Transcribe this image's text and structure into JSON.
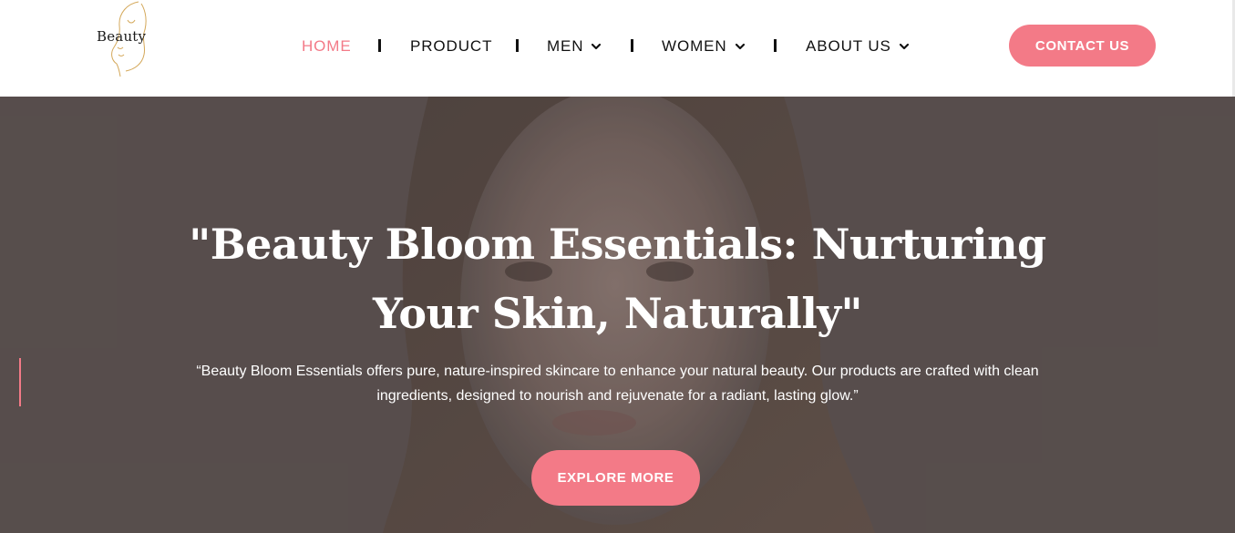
{
  "brand": {
    "logo_text": "Beauty"
  },
  "nav": {
    "items": [
      {
        "label": "HOME",
        "active": true,
        "has_dropdown": false
      },
      {
        "label": "PRODUCT",
        "active": false,
        "has_dropdown": false
      },
      {
        "label": "MEN",
        "active": false,
        "has_dropdown": true
      },
      {
        "label": "WOMEN",
        "active": false,
        "has_dropdown": true
      },
      {
        "label": "ABOUT US",
        "active": false,
        "has_dropdown": true
      }
    ],
    "dropdown_icon": "chevron-down-icon"
  },
  "header": {
    "contact_label": "CONTACT US"
  },
  "hero": {
    "title": "\"Beauty Bloom Essentials: Nurturing Your Skin, Naturally\"",
    "description": "“Beauty Bloom Essentials offers pure, nature-inspired skincare to enhance your natural beauty. Our products are crafted with clean ingredients, designed to nourish and rejuvenate for a radiant, lasting glow.”",
    "cta_label": "EXPLORE MORE"
  },
  "colors": {
    "accent": "#f37a87",
    "hero_overlay": "#5d5452",
    "text_dark": "#111111",
    "white": "#ffffff"
  }
}
